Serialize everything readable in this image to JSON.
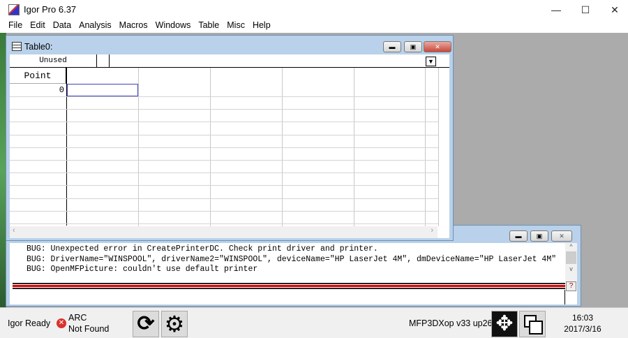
{
  "app": {
    "title": "Igor Pro 6.37",
    "window_controls": {
      "minimize": "—",
      "maximize": "☐",
      "close": "✕"
    }
  },
  "menu": [
    "File",
    "Edit",
    "Data",
    "Analysis",
    "Macros",
    "Windows",
    "Table",
    "Misc",
    "Help"
  ],
  "table_window": {
    "title": "Table0:",
    "unused_label": "Unused",
    "point_header": "Point",
    "rows": [
      "0"
    ]
  },
  "command_window": {
    "lines": [
      "BUG: Unexpected error in CreatePrinterDC. Check print driver and printer.",
      "BUG: DriverName=\"WINSPOOL\", driverName2=\"WINSPOOL\", deviceName=\"HP LaserJet 4M\", dmDeviceName=\"HP LaserJet 4M\"",
      "BUG: OpenMFPicture: couldn't use default printer"
    ],
    "help_button": "?"
  },
  "status": {
    "ready": "Igor Ready",
    "arc_line1": "ARC",
    "arc_line2": "Not Found",
    "xop": "MFP3DXop v33 up26",
    "time": "16:03",
    "date": "2017/3/16"
  },
  "colors": {
    "accent": "#b9d1ea",
    "error": "#d9322e",
    "red_line": "#e00000"
  }
}
